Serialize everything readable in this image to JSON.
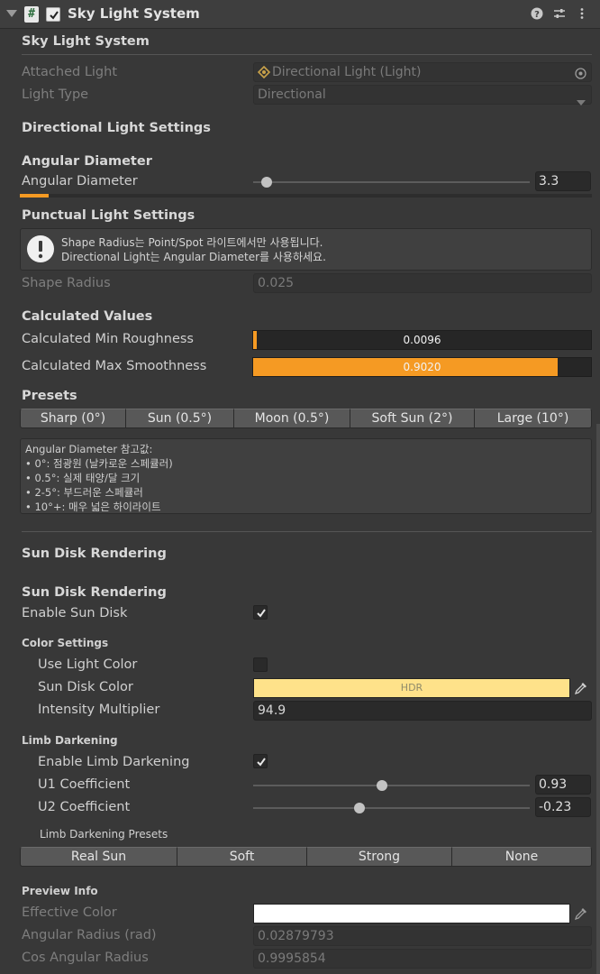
{
  "header": {
    "title": "Sky Light System",
    "script_icon_glyph": "#",
    "icons": [
      "help-icon",
      "presets-icon",
      "kebab-menu-icon"
    ]
  },
  "sky": {
    "heading": "Sky Light System",
    "attached_light_label": "Attached Light",
    "attached_light_value": "Directional Light (Light)",
    "light_type_label": "Light Type",
    "light_type_value": "Directional"
  },
  "directional": {
    "heading": "Directional Light Settings",
    "subheading": "Angular Diameter",
    "angular_label": "Angular Diameter",
    "angular_value": "3.3",
    "angular_slider_fraction": 0.05
  },
  "punctual": {
    "heading": "Punctual Light Settings",
    "help_line1": "Shape Radius는 Point/Spot 라이트에서만 사용됩니다.",
    "help_line2": "Directional Light는 Angular Diameter를 사용하세요.",
    "shape_radius_label": "Shape Radius",
    "shape_radius_value": "0.025"
  },
  "calculated": {
    "heading": "Calculated Values",
    "min_rough_label": "Calculated Min Roughness",
    "min_rough_value": "0.0096",
    "min_rough_fraction": 0.0096,
    "max_smooth_label": "Calculated Max Smoothness",
    "max_smooth_value": "0.9020",
    "max_smooth_fraction": 0.902
  },
  "presets": {
    "heading": "Presets",
    "buttons": [
      "Sharp (0°)",
      "Sun (0.5°)",
      "Moon (0.5°)",
      "Soft Sun (2°)",
      "Large (10°)"
    ],
    "info_title": "Angular Diameter 참고값:",
    "info_lines": [
      "• 0°: 점광원 (날카로운 스페큘러)",
      "• 0.5°: 실제 태양/달 크기",
      "• 2-5°: 부드러운 스페큘러",
      "• 10°+: 매우 넓은 하이라이트"
    ]
  },
  "sundisk": {
    "heading": "Sun Disk Rendering",
    "subheading": "Sun Disk Rendering",
    "enable_label": "Enable Sun Disk",
    "enable_checked": true,
    "color_settings": "Color Settings",
    "use_light_color_label": "Use Light Color",
    "use_light_color_checked": false,
    "sun_disk_color_label": "Sun Disk Color",
    "sun_disk_color": "#fee28a",
    "hdr_label": "HDR",
    "intensity_label": "Intensity Multiplier",
    "intensity_value": "94.9"
  },
  "limb": {
    "heading": "Limb Darkening",
    "enable_label": "Enable Limb Darkening",
    "enable_checked": true,
    "u1_label": "U1 Coefficient",
    "u1_value": "0.93",
    "u1_fraction": 0.465,
    "u2_label": "U2 Coefficient",
    "u2_value": "-0.23",
    "u2_fraction": 0.385,
    "presets_label": "Limb Darkening Presets",
    "preset_buttons": [
      "Real Sun",
      "Soft",
      "Strong",
      "None"
    ]
  },
  "preview": {
    "heading": "Preview Info",
    "effective_color_label": "Effective Color",
    "effective_color": "#ffffff",
    "angular_radius_label": "Angular Radius (rad)",
    "angular_radius_value": "0.02879793",
    "cos_label": "Cos Angular Radius",
    "cos_value": "0.9995854"
  },
  "colors": {
    "accent": "#f59a23",
    "background": "#383838"
  }
}
